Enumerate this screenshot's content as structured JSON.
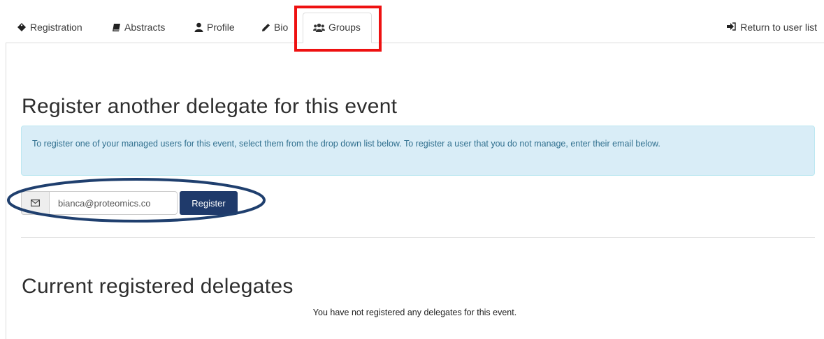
{
  "tabs": [
    {
      "label": "Registration",
      "icon": "tag-icon"
    },
    {
      "label": "Abstracts",
      "icon": "book-icon"
    },
    {
      "label": "Profile",
      "icon": "user-icon"
    },
    {
      "label": "Bio",
      "icon": "pencil-icon"
    },
    {
      "label": "Groups",
      "icon": "group-icon",
      "active": true
    }
  ],
  "return_link": {
    "label": "Return to user list",
    "icon": "sign-in-icon"
  },
  "register_section": {
    "title": "Register another delegate for this event",
    "info": "To register one of your managed users for this event, select them from the drop down list below. To register a user that you do not manage, enter their email below.",
    "email_value": "bianca@proteomics.co",
    "email_icon": "envelope-icon",
    "button_label": "Register"
  },
  "delegates_section": {
    "title": "Current registered delegates",
    "empty_message": "You have not registered any delegates for this event."
  },
  "colors": {
    "highlight": "#ee1111",
    "annotation": "#1f3f6e",
    "button": "#1f3a6b",
    "alert_bg": "#d9edf7",
    "alert_text": "#31708f"
  }
}
